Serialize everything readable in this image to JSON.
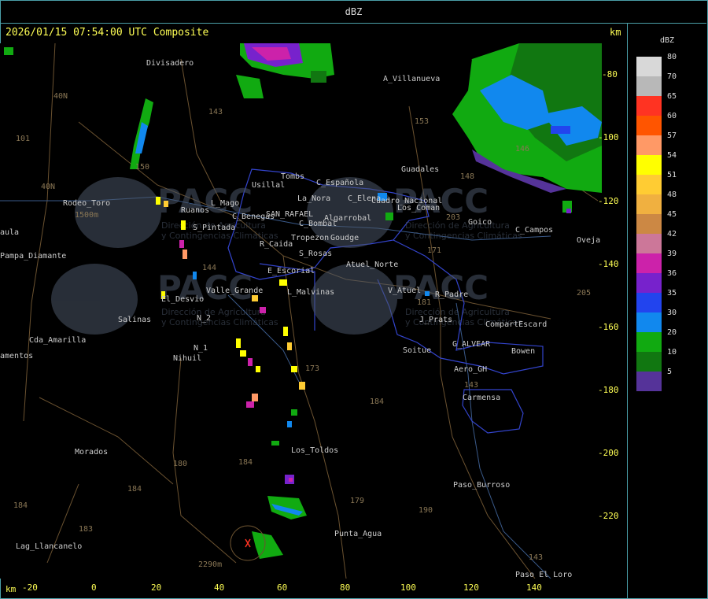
{
  "header": {
    "title": "dBZ"
  },
  "subtitle": "2026/01/15 07:54:00 UTC Composite",
  "units": {
    "top_right": "km",
    "bottom_left": "km"
  },
  "colorbar": {
    "title": "dBZ",
    "levels": [
      {
        "label": "80",
        "color": "#d8d8d8"
      },
      {
        "label": "70",
        "color": "#b8b8b8"
      },
      {
        "label": "65",
        "color": "#ff3322"
      },
      {
        "label": "60",
        "color": "#ff5500"
      },
      {
        "label": "57",
        "color": "#ff9966"
      },
      {
        "label": "54",
        "color": "#ffff00"
      },
      {
        "label": "51",
        "color": "#ffcc33"
      },
      {
        "label": "48",
        "color": "#f0b040"
      },
      {
        "label": "45",
        "color": "#cc8844"
      },
      {
        "label": "42",
        "color": "#cc7799"
      },
      {
        "label": "39",
        "color": "#cc22aa"
      },
      {
        "label": "36",
        "color": "#7722cc"
      },
      {
        "label": "35",
        "color": "#2244ee"
      },
      {
        "label": "30",
        "color": "#1188ee"
      },
      {
        "label": "20",
        "color": "#11aa11"
      },
      {
        "label": "10",
        "color": "#117711"
      },
      {
        "label": "5",
        "color": "#553399"
      }
    ]
  },
  "x_axis": {
    "ticks": [
      "-20",
      "0",
      "20",
      "40",
      "60",
      "80",
      "100",
      "120",
      "140"
    ]
  },
  "y_axis": {
    "ticks": [
      "-80",
      "-100",
      "-120",
      "-140",
      "-160",
      "-180",
      "-200",
      "-220"
    ]
  },
  "watermark": {
    "text": "PACC",
    "line1": "Dirección de Agricultura",
    "line2": "y Contingencias Climáticas"
  },
  "places": [
    "Divisadero",
    "A_Villanueva",
    "Guadales",
    "La_Nora",
    "C_Española",
    "C_Elena",
    "Usillal",
    "Tombs",
    "C_Benegas",
    "SAN_RAFAEL",
    "Algarrobal",
    "C_Bombal",
    "Cuadro_Nacional",
    "Los_Coman",
    "Goico",
    "C_Campos",
    "Oveja",
    "Rodeo_Toro",
    "Ruanos",
    "L_Mago",
    "S_Pintada",
    "Pampa_Diamante",
    "aula",
    "R_Caida",
    "Tropezon",
    "Goudge",
    "S_Rosas",
    "Atuel_Norte",
    "E_Escorial",
    "El_Desvio",
    "Valle_Grande",
    "L_Malvinas",
    "V_Atuel",
    "R_Padre",
    "J_Prats",
    "CompartEscard",
    "Salinas",
    "N_2",
    "N_1",
    "Nihuil",
    "Cda_Amarilla",
    "Soitue",
    "G_ALVEAR",
    "Bowen",
    "Aero_GH",
    "Carmensa",
    "Los_Toldos",
    "Morados",
    "Paso_Burroso",
    "Punta_Agua",
    "Lag_Llancanelo",
    "Paso_El_Loro",
    "amentos"
  ],
  "route_numbers": [
    "143",
    "153",
    "146",
    "101",
    "40N",
    "150",
    "148",
    "203",
    "171",
    "144",
    "181",
    "173",
    "205",
    "184",
    "180",
    "190",
    "179",
    "183",
    "143",
    "2290m",
    "1500m"
  ]
}
